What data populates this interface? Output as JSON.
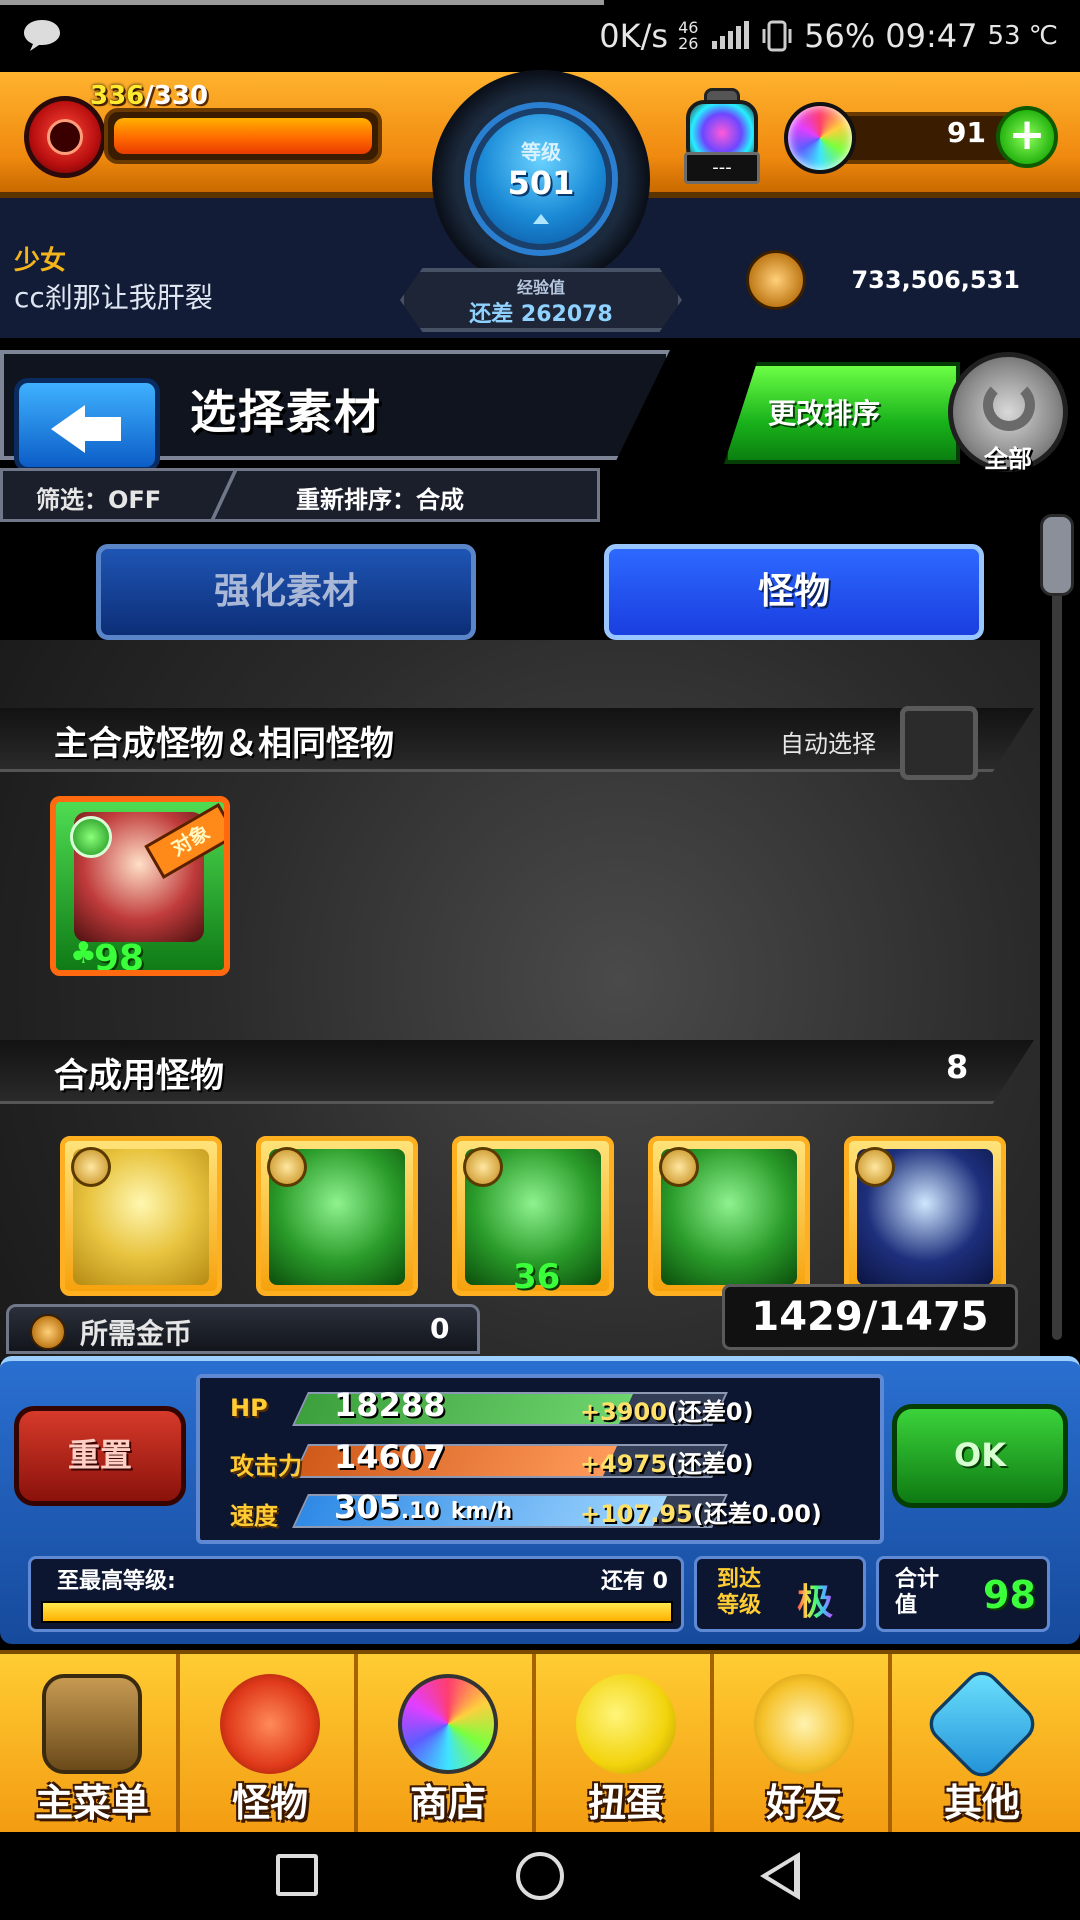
{
  "status_bar": {
    "speed": "0K/s",
    "network_top": "46",
    "network_bottom": "26",
    "battery": "56%",
    "time": "09:47",
    "temperature": "53 ℃"
  },
  "header": {
    "stamina_current": "336",
    "stamina_max": "/330",
    "level_label": "等级",
    "level_value": "501",
    "exp_label": "经验值",
    "exp_value": "还差 262078",
    "item_slot_text": "---",
    "orbs": "91",
    "orb_add": "+",
    "player_title": "少女",
    "player_name": "cc刹那让我肝裂",
    "gold": "733,506,531"
  },
  "page": {
    "title": "选择素材",
    "filter": "筛选：OFF",
    "sort": "重新排序：合成",
    "change_sort": "更改排序",
    "refresh_label": "全部"
  },
  "tabs": {
    "enhance": "强化素材",
    "monster": "怪物"
  },
  "sections": {
    "main_title": "主合成怪物＆相同怪物",
    "auto_select": "自动选择",
    "material_title": "合成用怪物",
    "material_count": "8"
  },
  "main_card": {
    "tag": "对象",
    "luck": "98"
  },
  "materials": [
    {
      "level": ""
    },
    {
      "level": ""
    },
    {
      "level": "36"
    },
    {
      "level": ""
    },
    {
      "level": ""
    }
  ],
  "box_capacity": "1429/1475",
  "required_gold": {
    "label": "所需金币",
    "value": "0"
  },
  "buttons": {
    "reset": "重置",
    "ok": "OK"
  },
  "stats": {
    "hp": {
      "label": "HP",
      "value": "18288",
      "bonus": "+3900",
      "gap": "(还差0)",
      "fill": 0.78
    },
    "atk": {
      "label": "攻击力",
      "value": "14607",
      "bonus": "+4975",
      "gap": "(还差0)",
      "fill": 0.74
    },
    "spd": {
      "label": "速度",
      "value": "305",
      "decimal": ".10",
      "unit": "km/h",
      "bonus": "+107.95",
      "gap": "(还差0.00)",
      "fill": 0.86
    }
  },
  "level_progress": {
    "label": "至最高等级:",
    "remaining": "还有 0",
    "fill": 1.0
  },
  "reach": {
    "label": "到达等级",
    "value": "极"
  },
  "total": {
    "label": "合计值",
    "value": "98"
  },
  "nav": {
    "home": "主菜单",
    "monster": "怪物",
    "shop": "商店",
    "gacha": "扭蛋",
    "friends": "好友",
    "other": "其他"
  }
}
